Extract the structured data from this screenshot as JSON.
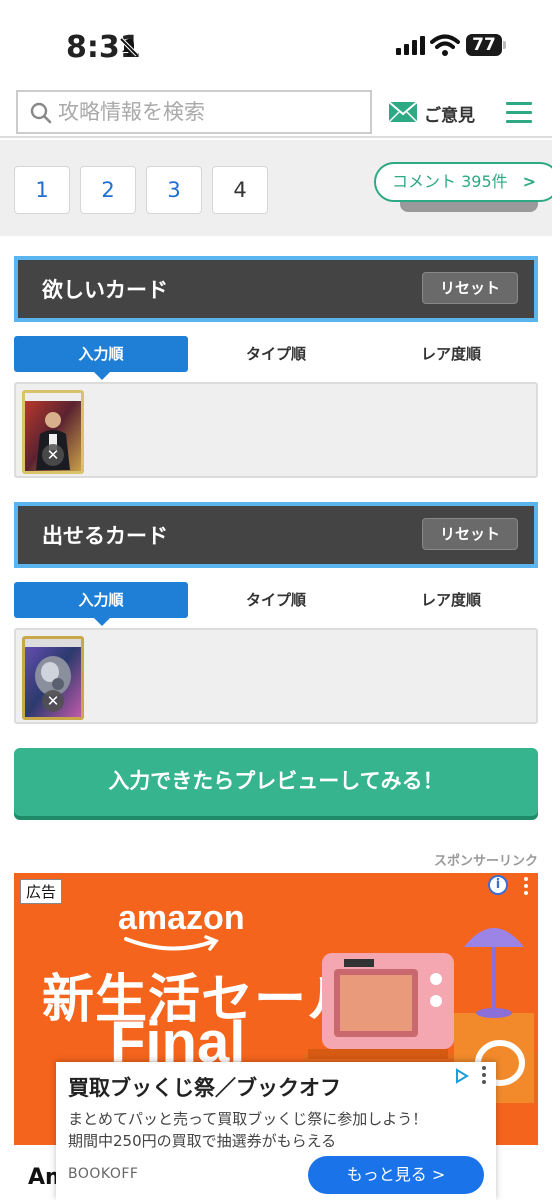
{
  "status_bar": {
    "time": "8:31",
    "battery": "77"
  },
  "header": {
    "search_placeholder": "攻略情報を検索",
    "opinion_label": "ご意見"
  },
  "pager": {
    "pages": [
      "1",
      "2",
      "3",
      "4"
    ],
    "current": "4",
    "comment_label": "コメント  395件",
    "comment_chevron": ">"
  },
  "want_section": {
    "title": "欲しいカード",
    "reset_label": "リセット",
    "tabs": [
      "入力順",
      "タイプ順",
      "レア度順"
    ],
    "active_tab": "入力順"
  },
  "give_section": {
    "title": "出せるカード",
    "reset_label": "リセット",
    "tabs": [
      "入力順",
      "タイプ順",
      "レア度順"
    ],
    "active_tab": "入力順"
  },
  "card_remove_glyph": "✕",
  "preview_button": "入力できたらプレビューしてみる！",
  "sponsor_label": "スポンサーリンク",
  "ad": {
    "label": "広告",
    "info_glyph": "i",
    "brand_word": "amazon",
    "headline": "新生活セール",
    "final_word": "Final",
    "cut_text": "Am",
    "overlay": {
      "title": "買取ブッくじ祭／ブックオフ",
      "desc_line1": "まとめてパッと売って買取ブッくじ祭に参加しよう！",
      "desc_line2": "期間中250円の買取で抽選券がもらえる",
      "brand": "BOOKOFF",
      "more_label": "もっと見る  >"
    }
  },
  "colors": {
    "accent_green": "#36b48e",
    "tab_blue": "#1f7fd6",
    "section_border": "#5ab4ef",
    "ad_orange": "#f5641c",
    "more_blue": "#1a73e8"
  }
}
